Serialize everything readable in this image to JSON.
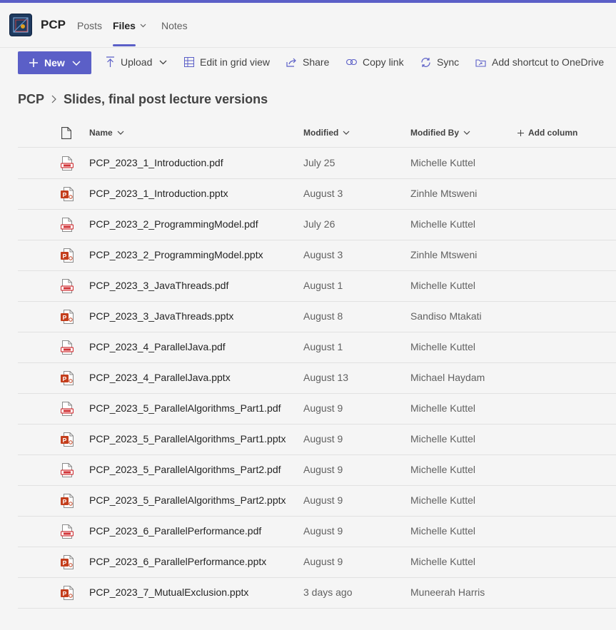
{
  "app": {
    "name": "PCP",
    "tabs": [
      {
        "label": "Posts"
      },
      {
        "label": "Files"
      },
      {
        "label": "Notes"
      }
    ]
  },
  "toolbar": {
    "new_label": "New",
    "upload_label": "Upload",
    "grid_label": "Edit in grid view",
    "share_label": "Share",
    "copylink_label": "Copy link",
    "sync_label": "Sync",
    "shortcut_label": "Add shortcut to OneDrive"
  },
  "breadcrumb": {
    "root": "PCP",
    "current": "Slides, final post lecture versions"
  },
  "columns": {
    "name": "Name",
    "modified": "Modified",
    "modified_by": "Modified By",
    "add_column": "Add column"
  },
  "files": [
    {
      "name": "PCP_2023_1_Introduction.pdf",
      "modified": "July 25",
      "by": "Michelle Kuttel",
      "type": "pdf"
    },
    {
      "name": "PCP_2023_1_Introduction.pptx",
      "modified": "August 3",
      "by": "Zinhle Mtsweni",
      "type": "pptx"
    },
    {
      "name": "PCP_2023_2_ProgrammingModel.pdf",
      "modified": "July 26",
      "by": "Michelle Kuttel",
      "type": "pdf"
    },
    {
      "name": "PCP_2023_2_ProgrammingModel.pptx",
      "modified": "August 3",
      "by": "Zinhle Mtsweni",
      "type": "pptx"
    },
    {
      "name": "PCP_2023_3_JavaThreads.pdf",
      "modified": "August 1",
      "by": "Michelle Kuttel",
      "type": "pdf"
    },
    {
      "name": "PCP_2023_3_JavaThreads.pptx",
      "modified": "August 8",
      "by": "Sandiso Mtakati",
      "type": "pptx"
    },
    {
      "name": "PCP_2023_4_ParallelJava.pdf",
      "modified": "August 1",
      "by": "Michelle Kuttel",
      "type": "pdf"
    },
    {
      "name": "PCP_2023_4_ParallelJava.pptx",
      "modified": "August 13",
      "by": "Michael Haydam",
      "type": "pptx"
    },
    {
      "name": "PCP_2023_5_ParallelAlgorithms_Part1.pdf",
      "modified": "August 9",
      "by": "Michelle Kuttel",
      "type": "pdf"
    },
    {
      "name": "PCP_2023_5_ParallelAlgorithms_Part1.pptx",
      "modified": "August 9",
      "by": "Michelle Kuttel",
      "type": "pptx"
    },
    {
      "name": "PCP_2023_5_ParallelAlgorithms_Part2.pdf",
      "modified": "August 9",
      "by": "Michelle Kuttel",
      "type": "pdf"
    },
    {
      "name": "PCP_2023_5_ParallelAlgorithms_Part2.pptx",
      "modified": "August 9",
      "by": "Michelle Kuttel",
      "type": "pptx"
    },
    {
      "name": "PCP_2023_6_ParallelPerformance.pdf",
      "modified": "August 9",
      "by": "Michelle Kuttel",
      "type": "pdf"
    },
    {
      "name": "PCP_2023_6_ParallelPerformance.pptx",
      "modified": "August 9",
      "by": "Michelle Kuttel",
      "type": "pptx"
    },
    {
      "name": "PCP_2023_7_MutualExclusion.pptx",
      "modified": "3 days ago",
      "by": "Muneerah Harris",
      "type": "pptx"
    }
  ],
  "colors": {
    "accent": "#5b5fc7",
    "pdf_red": "#d13438",
    "pptx_orange": "#c43e1c"
  }
}
